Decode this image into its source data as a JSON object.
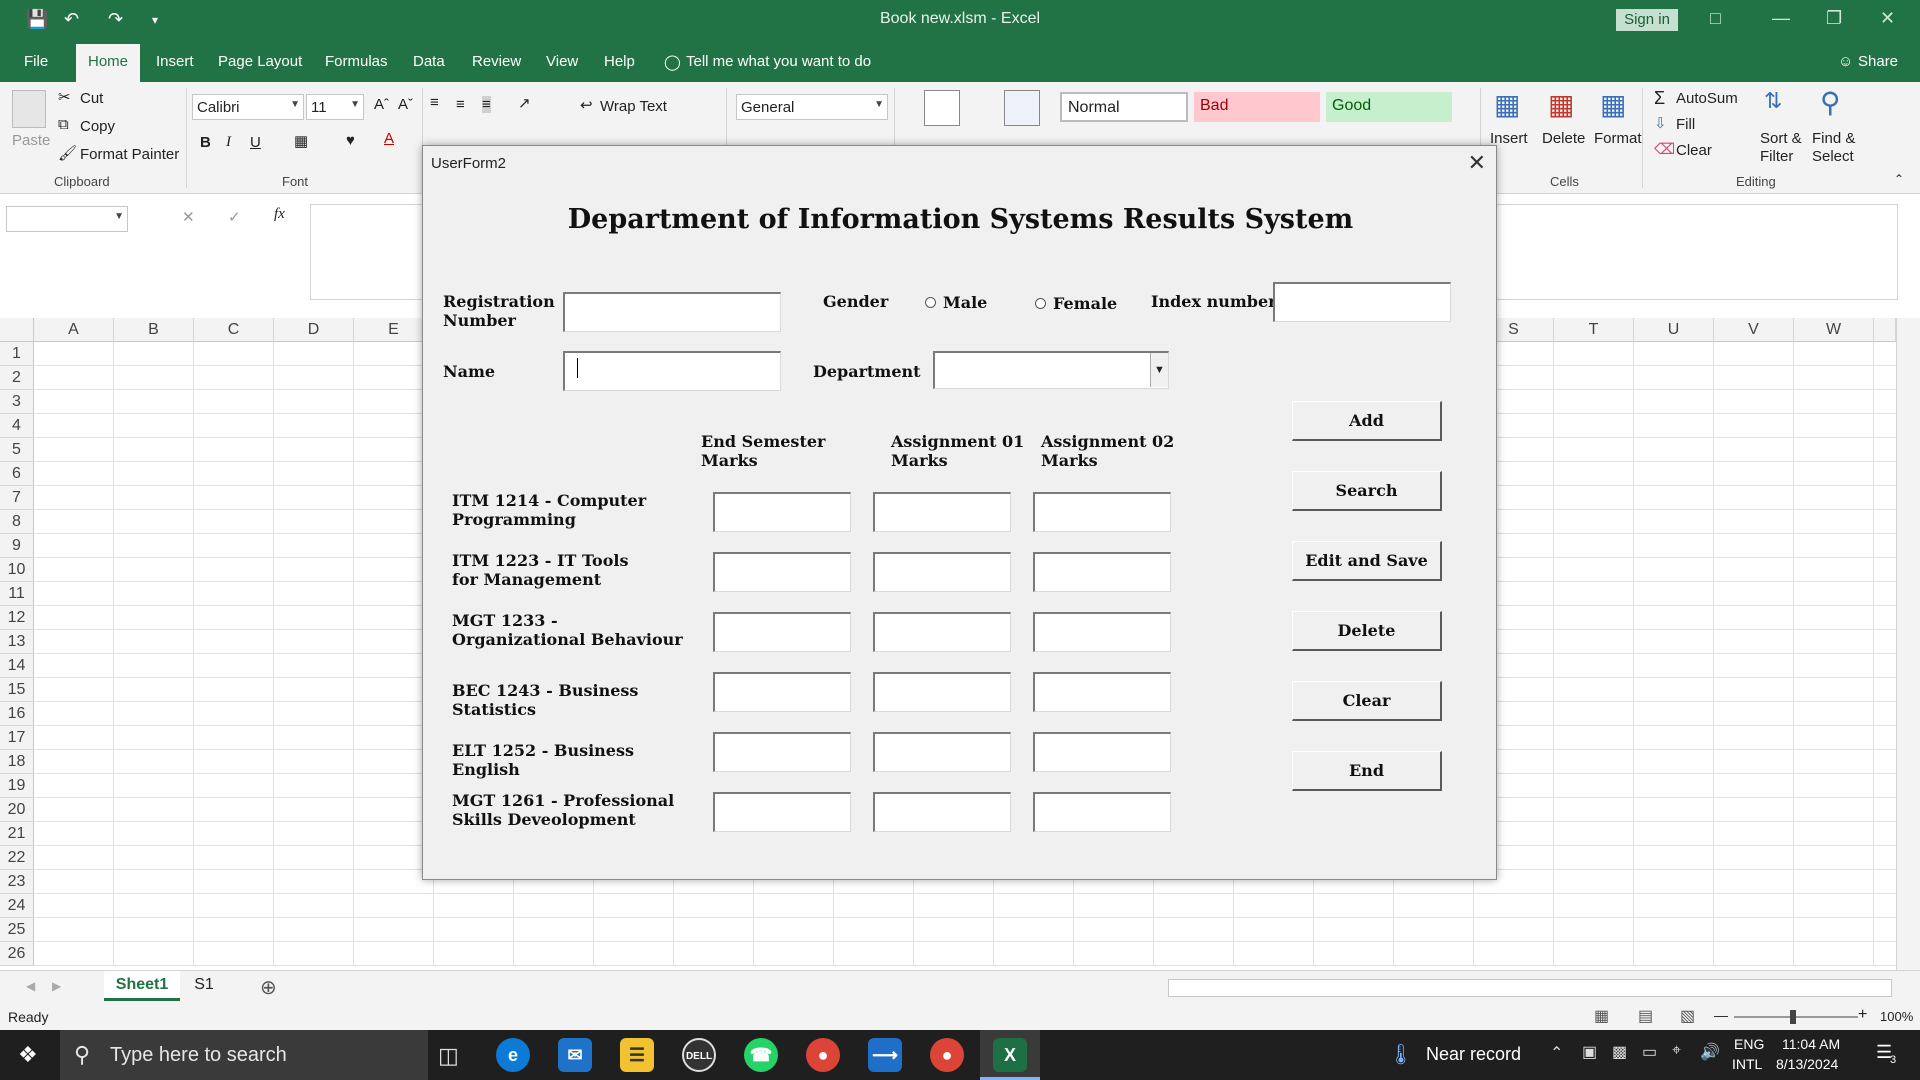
{
  "window": {
    "title": "Book new.xlsm  -  Excel",
    "signin_label": "Sign in",
    "share_label": "Share"
  },
  "tabs": [
    "File",
    "Home",
    "Insert",
    "Page Layout",
    "Formulas",
    "Data",
    "Review",
    "View",
    "Help"
  ],
  "tell_me": "Tell me what you want to do",
  "ribbon": {
    "clipboard": {
      "paste": "Paste",
      "cut": "Cut",
      "copy": "Copy",
      "format_painter": "Format Painter",
      "label": "Clipboard"
    },
    "font": {
      "name": "Calibri",
      "size": "11",
      "label": "Font"
    },
    "alignment": {
      "wrap_text": "Wrap Text"
    },
    "number": {
      "format": "General"
    },
    "styles": {
      "normal": "Normal",
      "bad": "Bad",
      "good": "Good"
    },
    "cells": {
      "insert": "Insert",
      "delete": "Delete",
      "format": "Format",
      "label": "Cells"
    },
    "editing": {
      "autosum": "AutoSum",
      "fill": "Fill",
      "clear": "Clear",
      "sort_filter": "Sort & Filter",
      "find_select": "Find & Select",
      "label": "Editing"
    }
  },
  "grid": {
    "left_columns": [
      "A",
      "B",
      "C",
      "D",
      "E"
    ],
    "right_columns": [
      "S",
      "T",
      "U",
      "V",
      "W"
    ],
    "rows": [
      "1",
      "2",
      "3",
      "4",
      "5",
      "6",
      "7",
      "8",
      "9",
      "10",
      "11",
      "12",
      "13",
      "14",
      "15",
      "16",
      "17",
      "18",
      "19",
      "20",
      "21",
      "22",
      "23",
      "24",
      "25",
      "26"
    ]
  },
  "sheets": {
    "active": "Sheet1",
    "other": "S1"
  },
  "status": {
    "ready": "Ready",
    "zoom": "100%"
  },
  "taskbar": {
    "search_placeholder": "Type here to search",
    "weather": "Near record",
    "lang1": "ENG",
    "lang2": "INTL",
    "time": "11:04 AM",
    "date": "8/13/2024",
    "notifications": "3"
  },
  "dialog": {
    "title": "UserForm2",
    "heading": "Department of Information Systems Results System",
    "registration_label": "Registration Number",
    "gender_label": "Gender",
    "male_label": "Male",
    "female_label": "Female",
    "index_label": "Index number",
    "name_label": "Name",
    "department_label": "Department",
    "col_headers": [
      "End Semester Marks",
      "Assignment 01 Marks",
      "Assignment 02 Marks"
    ],
    "subjects": [
      "ITM 1214 - Computer Programming",
      "ITM 1223 - IT Tools for Management",
      "MGT 1233 - Organizational Behaviour",
      "BEC 1243 - Business Statistics",
      "ELT 1252 - Business English",
      "MGT 1261 - Professional Skills Deveolopment"
    ],
    "buttons": [
      "Add",
      "Search",
      "Edit and Save",
      "Delete",
      "Clear",
      "End"
    ]
  }
}
